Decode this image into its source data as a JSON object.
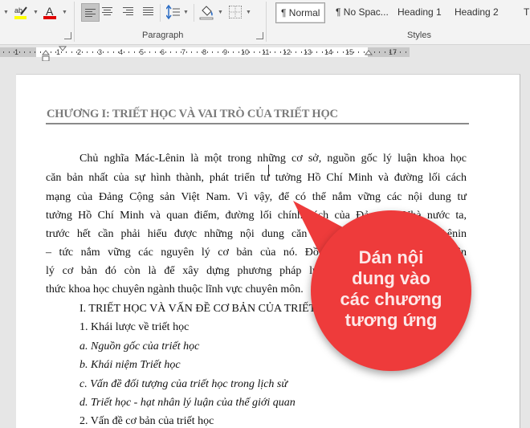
{
  "ribbon": {
    "font_group": {
      "highlight_color": "#ffff00",
      "font_color": "#e00000"
    },
    "paragraph_group": {
      "label": "Paragraph"
    },
    "styles_group": {
      "label": "Styles",
      "items": [
        {
          "label": "¶ Normal",
          "selected": true
        },
        {
          "label": "¶ No Spac...",
          "selected": false
        },
        {
          "label": "Heading 1",
          "selected": false
        },
        {
          "label": "Heading 2",
          "selected": false
        },
        {
          "label": "T",
          "selected": false
        }
      ]
    }
  },
  "ruler": {
    "numbers": [
      "1",
      "1",
      "2",
      "3",
      "4",
      "5",
      "6",
      "7",
      "8",
      "9",
      "10",
      "11",
      "12",
      "13",
      "14",
      "15",
      "17"
    ]
  },
  "document": {
    "chapter_title": "CHƯƠNG I: TRIẾT HỌC VÀ VAI TRÒ CỦA TRIẾT HỌC",
    "paragraph_lines": [
      "Chủ nghĩa Mác-Lênin là một trong những cơ sở, nguồn gốc lý luận khoa học",
      "căn bản nhất của sự hình thành, phát triển tư tưởng Hồ Chí Minh và đường lối cách",
      "mạng của Đảng Cộng sản Việt Nam. Vì vậy, để có thể nắm vững các nội dung tư",
      "tưởng Hồ Chí Minh và quan điểm, đường lối chính sách của Đảng và Nhà nước ta,",
      "trước hết cần phải hiểu được những nội dung căn bản của chủ nghĩa Mác-Lênin",
      "– tức nắm vững các nguyên lý cơ bản của nó. Đồng thời, học tập các nguyên",
      "lý cơ bản đó còn là để xây dựng phương pháp luận khoa học để tiếp cận tri",
      "thức khoa học chuyên ngành thuộc lĩnh vực chuyên môn."
    ],
    "outline": [
      {
        "text": "I. TRIẾT HỌC VÀ VẤN ĐỀ CƠ BẢN CỦA TRIẾT HỌC",
        "italic": false
      },
      {
        "text": "1. Khái lược về triết học",
        "italic": false
      },
      {
        "text": "a.  Nguồn gốc của triết học",
        "italic": true
      },
      {
        "text": "b. Khái niệm Triết học",
        "italic": true
      },
      {
        "text": "c. Vấn đề đối tượng của triết học trong lịch sử",
        "italic": true
      },
      {
        "text": "d. Triết học - hạt nhân lý luận của thế giới quan",
        "italic": true
      },
      {
        "text": "2. Vấn đề cơ bản của triết học",
        "italic": false
      }
    ]
  },
  "callout": {
    "text_lines": [
      "Dán nội",
      "dung vào",
      "các chương",
      "tương ứng"
    ],
    "color": "#ee3b3b"
  }
}
